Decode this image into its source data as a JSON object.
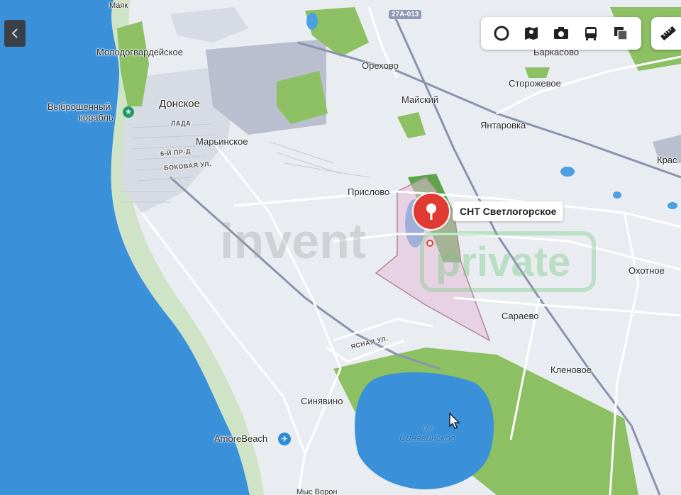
{
  "map": {
    "places": {
      "top_left": "Маяк",
      "molodogvardeyskoe": "Молодогвардейское",
      "shipwreck_1": "Выброшенный",
      "shipwreck_2": "корабль",
      "donskoe": "Донское",
      "lada": "ЛАДА",
      "street_6": "6-Й ПР-Д",
      "marinskoe": "Марьинское",
      "bokovaya": "БОКОВАЯ УЛ.",
      "orekhovo": "Орехово",
      "barkasovo": "Баркасово",
      "storozhevoe": "Сторожевое",
      "mayskiy": "Майский",
      "yantarovka": "Янтаровка",
      "kras": "Крас",
      "prislovo": "Прислово",
      "okhotnoe": "Охотное",
      "saraevo": "Сараево",
      "yasnaya": "ЯСНАЯ УЛ.",
      "klenovoe": "Кленовое",
      "sinyavino": "Синявино",
      "amore_beach": "AmoreBeach",
      "lake_1": "оз.",
      "lake_2": "Синявинское",
      "bottom": "Мыс Ворон"
    },
    "road_badge": "27А-013",
    "pin_label": "СНТ Светлогорское",
    "watermark_brand": "invent",
    "watermark_tag": "private",
    "colors": {
      "sea": "#3b91d9",
      "land": "#e9ecf1",
      "forest": "#8cc063",
      "urban": "#d7dbe3",
      "road": "#ffffff",
      "major_road": "#8a93ad",
      "pin": "#e03a32",
      "boundary": "#c9a0a8"
    }
  },
  "toolbar": {
    "icons": [
      "layers-icon",
      "panorama-icon",
      "photo-icon",
      "transit-icon",
      "map-type-icon"
    ],
    "ruler_icon": "ruler-icon",
    "collapse_icon": "chevron-left-icon"
  }
}
